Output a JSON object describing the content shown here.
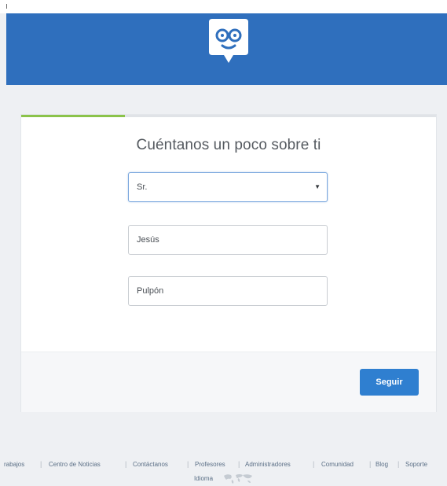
{
  "header": {
    "logo": "edmodo-mascot-icon",
    "brand_color": "#2f6fbd"
  },
  "signup": {
    "progress_fraction": 0.25,
    "title": "Cuéntanos un poco sobre ti",
    "title_select": {
      "value": "Sr."
    },
    "first_name": {
      "value": "Jesús"
    },
    "last_name": {
      "value": "Pulpón"
    },
    "next_label": "Seguir"
  },
  "footer": {
    "links": [
      "rabajos",
      "Centro de Noticias",
      "Contáctanos",
      "Profesores",
      "Administradores",
      "Comunidad",
      "Blog",
      "Soporte"
    ],
    "language_label": "Idioma",
    "language_icon": "world-map-icon"
  }
}
